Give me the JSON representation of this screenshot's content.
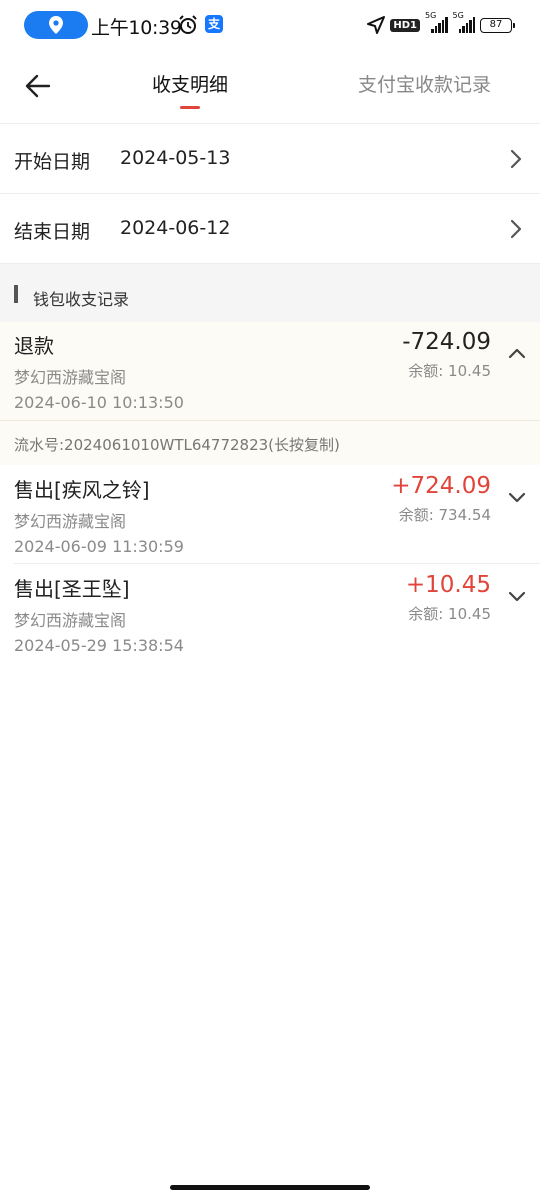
{
  "status_bar": {
    "time": "上午10:39",
    "hd_label": "HD1",
    "signal1_label": "5G",
    "signal2_label": "5G",
    "battery": "87",
    "accent": "#1a7cf0"
  },
  "nav": {
    "tab_active": "收支明细",
    "tab_inactive": "支付宝收款记录",
    "accent": "#e0443a"
  },
  "filters": {
    "start_label": "开始日期",
    "start_value": "2024-05-13",
    "end_label": "结束日期",
    "end_value": "2024-06-12"
  },
  "section": {
    "title": "钱包收支记录"
  },
  "records": [
    {
      "title": "退款",
      "shop": "梦幻西游藏宝阁",
      "time": "2024-06-10 10:13:50",
      "amount": "-724.09",
      "balance": "余额: 10.45",
      "expanded": true,
      "serial": "流水号:2024061010WTL64772823(长按复制)"
    },
    {
      "title": "售出[疾风之铃]",
      "shop": "梦幻西游藏宝阁",
      "time": "2024-06-09 11:30:59",
      "amount": "+724.09",
      "balance": "余额: 734.54",
      "expanded": false
    },
    {
      "title": "售出[圣王坠]",
      "shop": "梦幻西游藏宝阁",
      "time": "2024-05-29 15:38:54",
      "amount": "+10.45",
      "balance": "余额: 10.45",
      "expanded": false
    }
  ]
}
